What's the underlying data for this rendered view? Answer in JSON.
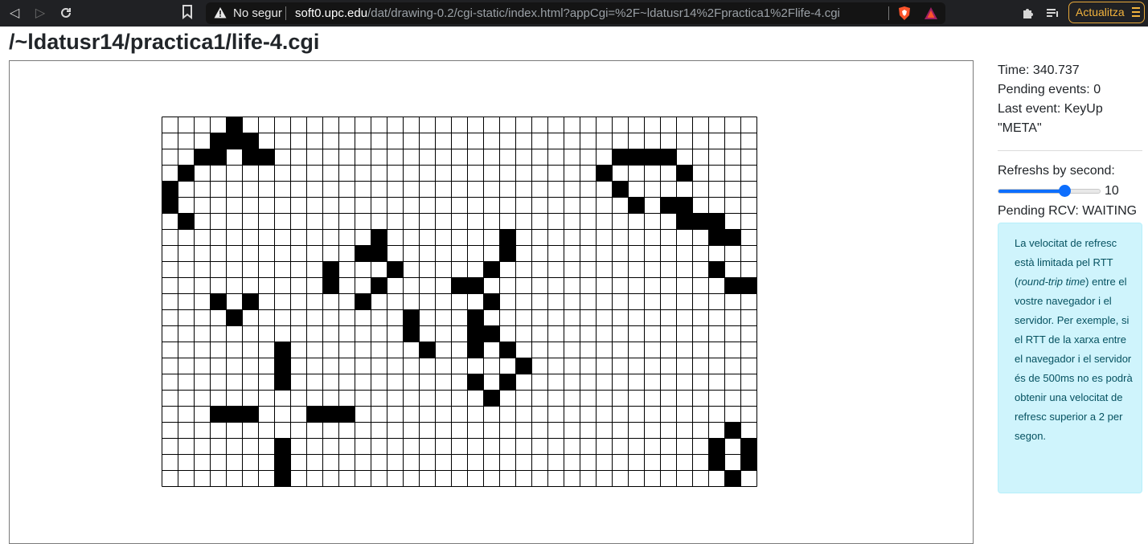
{
  "browser": {
    "security_label": "No segur",
    "url_host": "soft0.upc.edu",
    "url_rest": "/dat/drawing-0.2/cgi-static/index.html?appCgi=%2F~ldatusr14%2Fpractica1%2Flife-4.cgi",
    "update_label": "Actualitza",
    "colors": {
      "frame": "#202124",
      "update_accent": "#f2b33d"
    }
  },
  "page": {
    "title": "/~ldatusr14/practica1/life-4.cgi"
  },
  "status": {
    "time": "Time: 340.737",
    "pending_events": "Pending events: 0",
    "last_event": "Last event: KeyUp",
    "last_event_key": "\"META\"",
    "refresh_label": "Refreshs by second:",
    "refresh_value": "10",
    "refresh_fraction": 0.65,
    "pending_rcv": "Pending RCV: WAITING"
  },
  "info": {
    "text_before": "La velocitat de refresc està limitada pel RTT (",
    "text_italic": "round-trip time",
    "text_after": ") entre el vostre navegador i el servidor. Per exemple, si el RTT de la xarxa entre el navegador i el servidor és de 500ms no es podrà obtenir una velocitat de refresc superior a 2 per segon."
  },
  "life_grid": {
    "cols": 37,
    "rows": 23,
    "live_color": "#000000",
    "grid_color": "#000000",
    "live_cells": [
      [
        0,
        4
      ],
      [
        1,
        3
      ],
      [
        1,
        4
      ],
      [
        1,
        5
      ],
      [
        2,
        2
      ],
      [
        2,
        3
      ],
      [
        2,
        5
      ],
      [
        2,
        6
      ],
      [
        2,
        28
      ],
      [
        2,
        29
      ],
      [
        2,
        30
      ],
      [
        2,
        31
      ],
      [
        3,
        1
      ],
      [
        3,
        27
      ],
      [
        3,
        32
      ],
      [
        4,
        0
      ],
      [
        4,
        28
      ],
      [
        5,
        0
      ],
      [
        5,
        29
      ],
      [
        5,
        31
      ],
      [
        5,
        32
      ],
      [
        6,
        1
      ],
      [
        6,
        32
      ],
      [
        6,
        33
      ],
      [
        6,
        34
      ],
      [
        7,
        13
      ],
      [
        7,
        21
      ],
      [
        7,
        34
      ],
      [
        7,
        35
      ],
      [
        8,
        12
      ],
      [
        8,
        13
      ],
      [
        8,
        21
      ],
      [
        9,
        10
      ],
      [
        9,
        14
      ],
      [
        9,
        20
      ],
      [
        9,
        34
      ],
      [
        10,
        10
      ],
      [
        10,
        13
      ],
      [
        10,
        18
      ],
      [
        10,
        19
      ],
      [
        10,
        35
      ],
      [
        10,
        36
      ],
      [
        11,
        3
      ],
      [
        11,
        5
      ],
      [
        11,
        12
      ],
      [
        11,
        20
      ],
      [
        12,
        4
      ],
      [
        12,
        15
      ],
      [
        12,
        19
      ],
      [
        13,
        15
      ],
      [
        13,
        19
      ],
      [
        13,
        20
      ],
      [
        14,
        7
      ],
      [
        14,
        16
      ],
      [
        14,
        19
      ],
      [
        14,
        21
      ],
      [
        15,
        7
      ],
      [
        15,
        22
      ],
      [
        16,
        7
      ],
      [
        16,
        19
      ],
      [
        16,
        21
      ],
      [
        17,
        20
      ],
      [
        18,
        3
      ],
      [
        18,
        4
      ],
      [
        18,
        5
      ],
      [
        18,
        9
      ],
      [
        18,
        10
      ],
      [
        18,
        11
      ],
      [
        19,
        35
      ],
      [
        20,
        7
      ],
      [
        20,
        34
      ],
      [
        20,
        36
      ],
      [
        21,
        7
      ],
      [
        21,
        34
      ],
      [
        21,
        36
      ],
      [
        22,
        7
      ],
      [
        22,
        35
      ]
    ]
  }
}
